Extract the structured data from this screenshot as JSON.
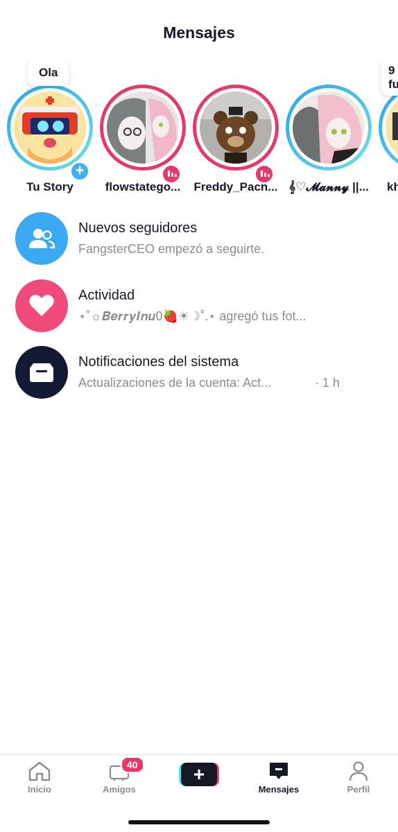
{
  "header": {
    "title": "Mensajes"
  },
  "stories": [
    {
      "name": "Tu Story",
      "bubble": "Ola",
      "ring": "blue",
      "badge": "plus"
    },
    {
      "name": "flowstatego...",
      "ring": "pink",
      "badge": "live"
    },
    {
      "name": "Freddy_Pach...",
      "ring": "pink",
      "badge": "live"
    },
    {
      "name": "𝄞♡𝓜𝓪𝓷𝓷𝔂 ||...",
      "ring": "blue",
      "badge": "none"
    },
    {
      "name": "kh",
      "bubble": "9\nfu",
      "ring": "blue",
      "badge": "none"
    }
  ],
  "list": [
    {
      "title": "Nuevos seguidores",
      "subtitle": "FangsterCEO empezó a seguirte.",
      "icon": "people-icon",
      "color": "#3aa8f2"
    },
    {
      "title": "Actividad",
      "subtitle": "⋆˚☼𝑩𝒆𝒓𝒓𝒚𝑰𝒏𝒖0🍓☀︎☽˚.⋆ agregó tus fot...",
      "icon": "heart-icon",
      "color": "#ef4a7a"
    },
    {
      "title": "Notificaciones del sistema",
      "subtitle": "Actualizaciones de la cuenta: Act...",
      "time": "· 1 h",
      "icon": "inbox-icon",
      "color": "#121a33"
    }
  ],
  "tabbar": {
    "home": "Inicio",
    "friends": "Amigos",
    "friends_badge": "40",
    "messages": "Mensajes",
    "profile": "Perfil"
  },
  "colors": {
    "accent": "#e6386b",
    "blue": "#3aa8f2",
    "dark": "#161823"
  }
}
